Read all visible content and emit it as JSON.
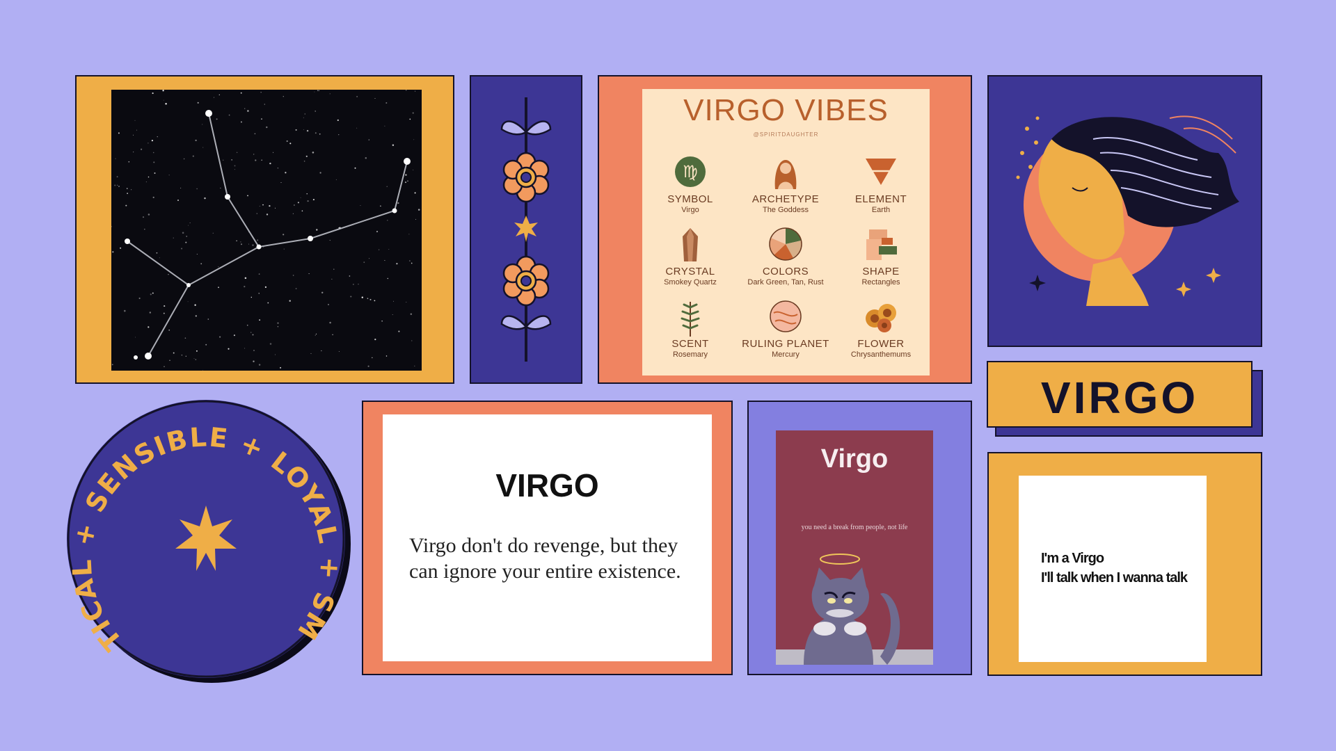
{
  "vibes": {
    "title": "VIRGO VIBES",
    "handle": "@SPIRITDAUGHTER",
    "items": [
      {
        "label": "SYMBOL",
        "value": "Virgo",
        "icon": "virgo-symbol-icon"
      },
      {
        "label": "ARCHETYPE",
        "value": "The Goddess",
        "icon": "goddess-icon"
      },
      {
        "label": "ELEMENT",
        "value": "Earth",
        "icon": "earth-triangle-icon"
      },
      {
        "label": "CRYSTAL",
        "value": "Smokey Quartz",
        "icon": "crystal-icon"
      },
      {
        "label": "COLORS",
        "value": "Dark Green, Tan, Rust",
        "icon": "color-wheel-icon"
      },
      {
        "label": "SHAPE",
        "value": "Rectangles",
        "icon": "rectangles-icon"
      },
      {
        "label": "SCENT",
        "value": "Rosemary",
        "icon": "rosemary-icon"
      },
      {
        "label": "RULING PLANET",
        "value": "Mercury",
        "icon": "mercury-planet-icon"
      },
      {
        "label": "FLOWER",
        "value": "Chrysanthemums",
        "icon": "chrysanthemum-icon"
      }
    ]
  },
  "banner": {
    "text": "VIRGO"
  },
  "badge": {
    "ring_text": "PRACTICAL + SENSIBLE + LOYAL + SMART +"
  },
  "quote1": {
    "title": "VIRGO",
    "text": "Virgo  don't do revenge, but they can ignore your entire existence."
  },
  "poster": {
    "title": "Virgo",
    "subtitle": "you need a break from people, not life"
  },
  "quote2": {
    "line1": "I'm a Virgo",
    "line2": "I'll talk when I wanna talk"
  },
  "colors": {
    "background": "#b1aff3",
    "mustard": "#efae47",
    "indigo": "#3d3695",
    "coral": "#f08461",
    "periwinkle": "#837fe0",
    "cream": "#fde5c5",
    "ink": "#14122a"
  }
}
